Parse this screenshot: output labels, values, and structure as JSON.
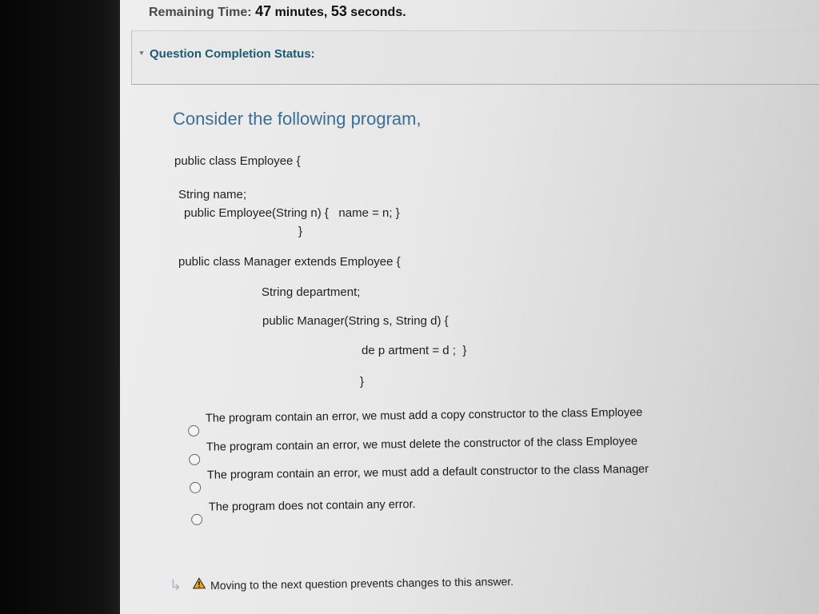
{
  "header": {
    "remaining_label": "Remaining Time:",
    "minutes_value": "47",
    "minutes_label": "minutes,",
    "seconds_value": "53",
    "seconds_label": "seconds."
  },
  "status": {
    "label": "Question Completion Status:",
    "icon": "chevron-down-icon"
  },
  "question": {
    "title": "Consider the following program,",
    "code": [
      "public class Employee {",
      "String name;",
      "public Employee(String n) {   name = n; }",
      "}",
      "public class Manager extends Employee {",
      "String department;",
      "public Manager(String s, String d) {",
      "de p artment = d ;  }",
      "}"
    ]
  },
  "options": [
    "The program contain an error, we must add a copy constructor to the class Employee",
    "The program contain an error, we must delete the  constructor of the class Employee",
    "The program contain an error, we must add a default constructor to the class Manager",
    "The program does not contain any error."
  ],
  "footer": {
    "warning": "Moving to the next question prevents changes to this answer.",
    "icons": [
      "arrow-return-icon",
      "warning-icon"
    ],
    "warning_color": "#e3a31b"
  },
  "colors": {
    "accent": "#1d5b72",
    "title": "#3b6f95"
  }
}
